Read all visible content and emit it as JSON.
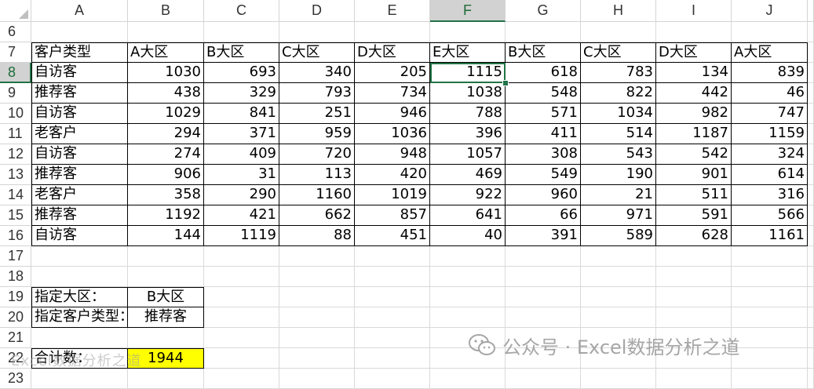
{
  "columns": [
    "A",
    "B",
    "C",
    "D",
    "E",
    "F",
    "G",
    "H",
    "I",
    "J"
  ],
  "active_column": "F",
  "active_row": "8",
  "rows": [
    "6",
    "7",
    "8",
    "9",
    "10",
    "11",
    "12",
    "13",
    "14",
    "15",
    "16",
    "17",
    "18",
    "19",
    "20",
    "21",
    "22",
    "23"
  ],
  "table": {
    "headers": [
      "客户类型",
      "A大区",
      "B大区",
      "C大区",
      "D大区",
      "E大区",
      "B大区",
      "C大区",
      "D大区",
      "A大区"
    ],
    "data": [
      [
        "自访客",
        "1030",
        "693",
        "340",
        "205",
        "1115",
        "618",
        "783",
        "134",
        "839"
      ],
      [
        "推荐客",
        "438",
        "329",
        "793",
        "734",
        "1038",
        "548",
        "822",
        "442",
        "46"
      ],
      [
        "自访客",
        "1029",
        "841",
        "251",
        "946",
        "788",
        "571",
        "1034",
        "982",
        "747"
      ],
      [
        "老客户",
        "294",
        "371",
        "959",
        "1036",
        "396",
        "411",
        "514",
        "1187",
        "1159"
      ],
      [
        "自访客",
        "274",
        "409",
        "720",
        "948",
        "1057",
        "308",
        "543",
        "542",
        "324"
      ],
      [
        "推荐客",
        "906",
        "31",
        "113",
        "420",
        "469",
        "549",
        "190",
        "901",
        "614"
      ],
      [
        "老客户",
        "358",
        "290",
        "1160",
        "1019",
        "922",
        "960",
        "21",
        "511",
        "316"
      ],
      [
        "推荐客",
        "1192",
        "421",
        "662",
        "857",
        "641",
        "66",
        "971",
        "591",
        "566"
      ],
      [
        "自访客",
        "144",
        "1119",
        "88",
        "451",
        "40",
        "391",
        "589",
        "628",
        "1161"
      ]
    ]
  },
  "criteria": {
    "region_label": "指定大区：",
    "region_value": "B大区",
    "type_label": "指定客户类型：",
    "type_value": "推荐客"
  },
  "total": {
    "label": "合计数：",
    "value": "1944"
  },
  "watermark": "公众号 · Excel数据分析之道",
  "faint_watermark": "Excel数据分析之道",
  "colors": {
    "selection": "#217346",
    "highlight": "#ffff00",
    "header_active": "#d2d2d2"
  }
}
